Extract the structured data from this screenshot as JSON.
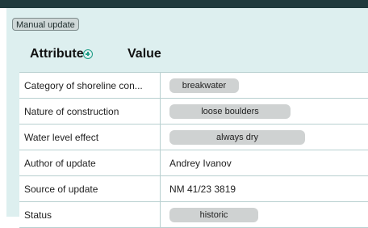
{
  "toolbar": {
    "manual_update_label": "Manual update"
  },
  "table": {
    "headers": {
      "attribute": "Attribute",
      "value": "Value"
    },
    "rows": [
      {
        "attribute": "Category of shoreline con...",
        "value": "breakwater",
        "type": "pill"
      },
      {
        "attribute": "Nature of construction",
        "value": "loose boulders",
        "type": "pill"
      },
      {
        "attribute": "Water level effect",
        "value": "always dry",
        "type": "pill"
      },
      {
        "attribute": "Author of update",
        "value": "Andrey Ivanov",
        "type": "text"
      },
      {
        "attribute": "Source of update",
        "value": "NM 41/23 3819",
        "type": "text"
      },
      {
        "attribute": "Status",
        "value": "historic",
        "type": "pill"
      }
    ]
  },
  "colors": {
    "panel_bg": "#ddefef",
    "topbar": "#1f3a3d",
    "pill_bg": "#cfd2d2",
    "accent": "#1e9d86"
  }
}
